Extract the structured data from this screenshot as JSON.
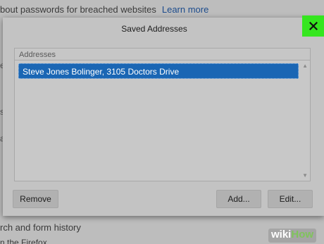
{
  "background": {
    "top_text": "bout passwords for breached websites",
    "top_link": "Learn more",
    "bottom_text": "rch and form history",
    "bottom_text2": "n the Firefox ..."
  },
  "dialog": {
    "title": "Saved Addresses",
    "close_icon": "close-icon",
    "list_header": "Addresses",
    "addresses": [
      "Steve Jones Bolinger, 3105 Doctors Drive"
    ],
    "buttons": {
      "remove": "Remove",
      "add": "Add...",
      "edit": "Edit..."
    }
  },
  "watermark": {
    "wiki": "wiki",
    "how": "How"
  },
  "colors": {
    "selection": "#1a66b4",
    "close_highlight": "#35e61f"
  }
}
